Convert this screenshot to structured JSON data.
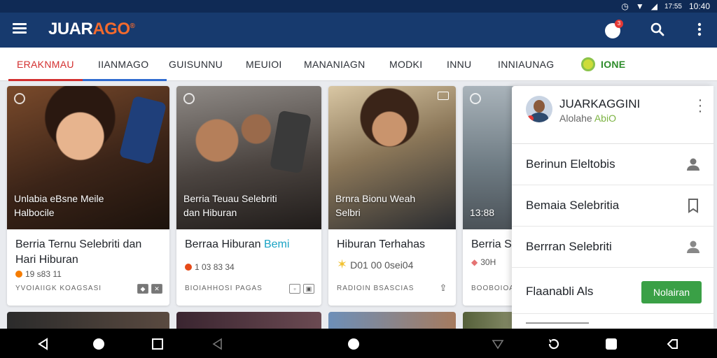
{
  "status_bar": {
    "time_small": "17:55",
    "time": "10:40"
  },
  "app": {
    "logo_main": "JUAR",
    "logo_accent": "AGO",
    "notification_count": "3"
  },
  "tabs": [
    {
      "label": "ERAKNMAU"
    },
    {
      "label": "IIANMAGO"
    },
    {
      "label": "GUISUNNU"
    },
    {
      "label": "MEUIOI"
    },
    {
      "label": "MANANIAGN"
    },
    {
      "label": "MODKI"
    },
    {
      "label": "INNU"
    },
    {
      "label": "INNIAUNAG"
    },
    {
      "label": "IONE"
    }
  ],
  "cards": [
    {
      "overlay_line1": "Unlabia eBsne Meile",
      "overlay_line2": "Halbocile",
      "title_line1": "Berria Ternu Selebriti dan",
      "title_line2": "Hari Hiburan",
      "meta": "19 s83 11",
      "source": "YVOIAIIGK KOAGSASI"
    },
    {
      "overlay_line1": "Berria Teuau Selebriti",
      "overlay_line2": "dan Hiburan",
      "title_plain": "Berraa Hiburan ",
      "title_accent": "Bemi",
      "meta": "1 03 83 34",
      "source": "BIOIAHHOSI PAGAS"
    },
    {
      "overlay_line1": "Brnra Bionu Weah",
      "overlay_line2": "Selbri",
      "title": "Hiburan Terhahas",
      "meta": "D01 00 0sei04",
      "source": "RADIOIN BSASCIAS"
    },
    {
      "overlay_line1": "13:88",
      "title": "Berria S",
      "meta": "30H",
      "source": "BOOBOIOAS"
    }
  ],
  "panel": {
    "profile_name": "JUARKAGGINI",
    "profile_sub_plain": "Alolahe ",
    "profile_sub_accent": "AbiO",
    "items": [
      {
        "label": "Berinun Eleltobis"
      },
      {
        "label": "Bemaia Selebritia"
      },
      {
        "label": "Berrran Selebriti"
      },
      {
        "label": "Flaanabli Als"
      }
    ],
    "follow_button": "Nolairan"
  },
  "colors": {
    "app_bar": "#173a6e",
    "active_tab": "#d32f2f",
    "accent_green": "#3aa046",
    "logo_accent": "#f26a2e"
  }
}
